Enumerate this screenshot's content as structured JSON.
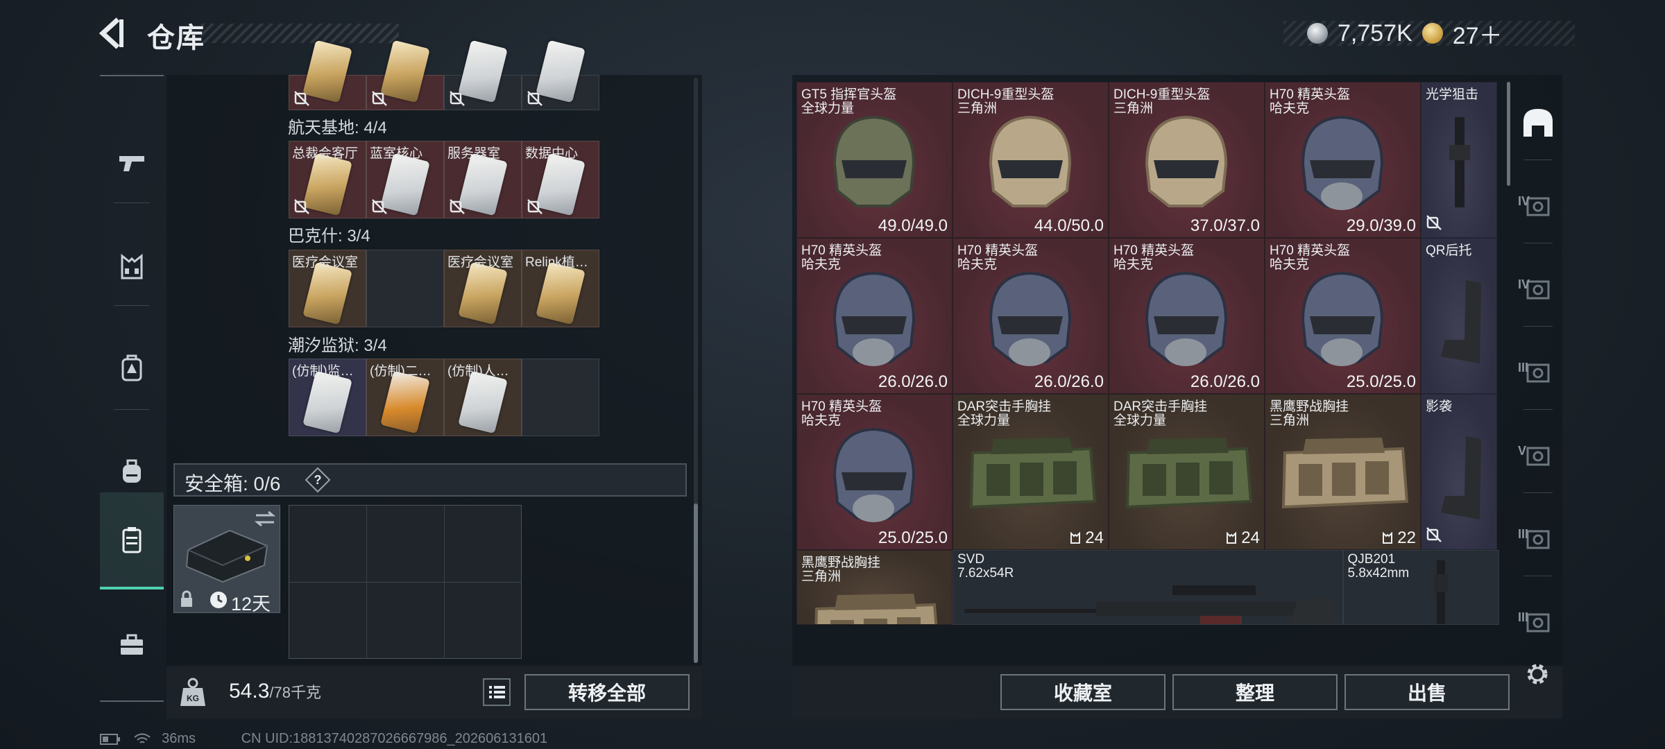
{
  "header": {
    "title": "仓库",
    "currency": [
      {
        "icon": "silver-coin-icon",
        "value": "7,757K"
      },
      {
        "icon": "gold-coin-icon",
        "value": "27＋"
      }
    ]
  },
  "left_nav": [
    {
      "icon": "pistol-icon"
    },
    {
      "icon": "vest-icon"
    },
    {
      "icon": "backpack-alert-icon"
    },
    {
      "icon": "backpack-icon"
    },
    {
      "icon": "keycard-case-icon",
      "active": true
    },
    {
      "icon": "toolbox-icon"
    }
  ],
  "key_sections": [
    {
      "title": "",
      "slots": [
        {
          "label": "",
          "style": "red",
          "card": "gold"
        },
        {
          "label": "",
          "style": "red",
          "card": "gold"
        },
        {
          "label": "",
          "style": "dark",
          "card": "silver"
        },
        {
          "label": "",
          "style": "dark",
          "card": "silver"
        }
      ]
    },
    {
      "title": "航天基地: 4/4",
      "slots": [
        {
          "label": "总裁会客厅",
          "style": "red",
          "card": "gold"
        },
        {
          "label": "蓝室核心",
          "style": "red",
          "card": "silver"
        },
        {
          "label": "服务器室",
          "style": "red",
          "card": "silver"
        },
        {
          "label": "数据中心",
          "style": "red",
          "card": "silver"
        }
      ]
    },
    {
      "title": "巴克什: 3/4",
      "slots": [
        {
          "label": "医疗会议室",
          "style": "brown",
          "card": "gold"
        },
        {
          "label": "",
          "style": "dark",
          "card": "none"
        },
        {
          "label": "医疗会议室",
          "style": "brown",
          "card": "gold"
        },
        {
          "label": "Relink植…",
          "style": "brown",
          "card": "gold"
        }
      ]
    },
    {
      "title": "潮汐监狱: 3/4",
      "slots": [
        {
          "label": "(仿制)监…",
          "style": "purple",
          "card": "silver"
        },
        {
          "label": "(仿制)二…",
          "style": "brown",
          "card": "orange"
        },
        {
          "label": "(仿制)人…",
          "style": "brown",
          "card": "silver"
        },
        {
          "label": "",
          "style": "dark",
          "card": "none"
        }
      ]
    }
  ],
  "safe_box": {
    "label": "安全箱: 0/6",
    "help": "?",
    "expiry": "12天"
  },
  "footer_left": {
    "weight_value": "54.3",
    "weight_max": "/78千克",
    "transfer_all": "转移全部"
  },
  "inventory": [
    {
      "name": "GT5 指挥官头盔",
      "sub": "全球力量",
      "style": "red",
      "kind": "helmet-green",
      "dura": "49.0/49.0"
    },
    {
      "name": "DICH-9重型头盔",
      "sub": "三角洲",
      "style": "red",
      "kind": "helmet-tan",
      "dura": "44.0/50.0"
    },
    {
      "name": "DICH-9重型头盔",
      "sub": "三角洲",
      "style": "red",
      "kind": "helmet-tan",
      "dura": "37.0/37.0"
    },
    {
      "name": "H70 精英头盔",
      "sub": "哈夫克",
      "style": "red",
      "kind": "helmet-navy",
      "dura": "29.0/39.0",
      "nolink": true
    },
    {
      "name": "光学狙击",
      "sub": "",
      "style": "purple",
      "kind": "scope",
      "nolink": true
    },
    {
      "name": "H70 精英头盔",
      "sub": "哈夫克",
      "style": "red",
      "kind": "helmet-navy",
      "dura": "26.0/26.0"
    },
    {
      "name": "H70 精英头盔",
      "sub": "哈夫克",
      "style": "red",
      "kind": "helmet-navy",
      "dura": "26.0/26.0"
    },
    {
      "name": "H70 精英头盔",
      "sub": "哈夫克",
      "style": "red",
      "kind": "helmet-navy",
      "dura": "26.0/26.0"
    },
    {
      "name": "H70 精英头盔",
      "sub": "哈夫克",
      "style": "red",
      "kind": "helmet-navy",
      "dura": "25.0/25.0"
    },
    {
      "name": "QR后托",
      "sub": "",
      "style": "purple",
      "kind": "stock"
    },
    {
      "name": "H70 精英头盔",
      "sub": "哈夫克",
      "style": "red",
      "kind": "helmet-navy",
      "dura": "25.0/25.0"
    },
    {
      "name": "DAR突击手胸挂",
      "sub": "全球力量",
      "style": "brown",
      "kind": "vest-green",
      "count": "24"
    },
    {
      "name": "DAR突击手胸挂",
      "sub": "全球力量",
      "style": "brown",
      "kind": "vest-green",
      "count": "24"
    },
    {
      "name": "黑鹰野战胸挂",
      "sub": "三角洲",
      "style": "brown",
      "kind": "vest-tan",
      "count": "22"
    },
    {
      "name": "影袭",
      "sub": "",
      "style": "purple",
      "kind": "stock2",
      "nolink": true
    },
    {
      "name": "黑鹰野战胸挂",
      "sub": "三角洲",
      "style": "brown",
      "kind": "vest-tan"
    },
    {
      "name": "SVD",
      "sub": "7.62x54R",
      "style": "dark",
      "kind": "rifle"
    },
    {
      "name": "QJB201",
      "sub": "5.8x42mm",
      "style": "dark",
      "kind": "mg"
    }
  ],
  "footer_right": {
    "collection": "收藏室",
    "sort": "整理",
    "sell": "出售"
  },
  "right_nav": [
    {
      "icon": "helmet-tab-icon",
      "roman": ""
    },
    {
      "icon": "tier4-box-icon",
      "roman": "IV"
    },
    {
      "icon": "tier4-folder-icon",
      "roman": "IV"
    },
    {
      "icon": "tier3-key-icon",
      "roman": "III"
    },
    {
      "icon": "tier5-box-icon",
      "roman": "V"
    },
    {
      "icon": "tier3-rifle-icon",
      "roman": "III"
    },
    {
      "icon": "tier3-ammo-icon",
      "roman": "III"
    }
  ],
  "status": {
    "ping": "36ms",
    "uid": "CN UID:18813740287026667986_202606131601"
  }
}
